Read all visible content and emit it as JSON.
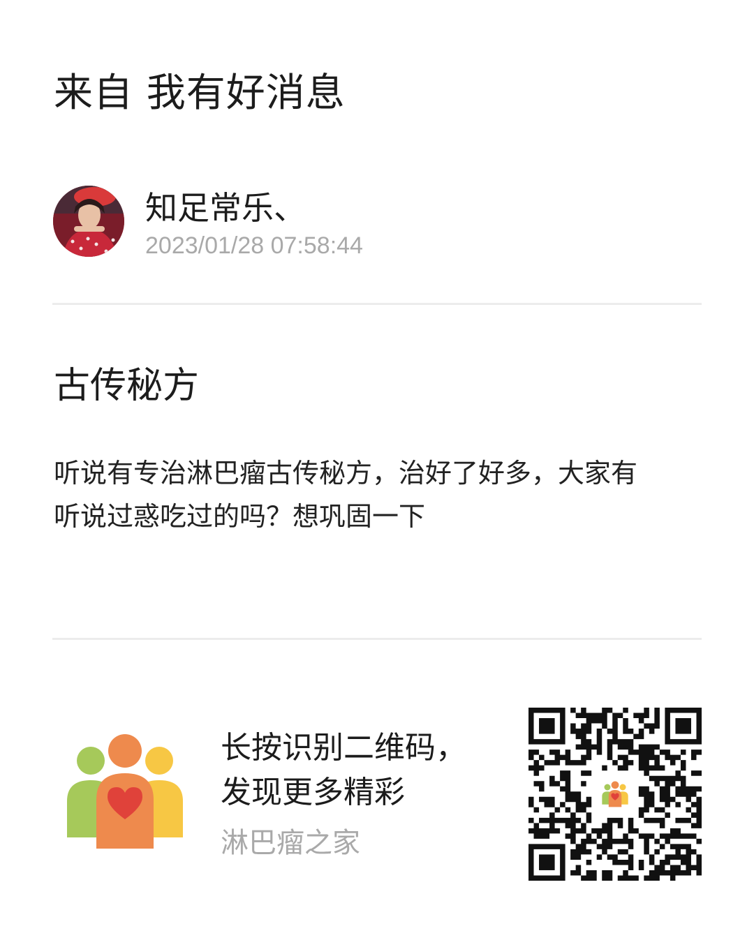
{
  "header": {
    "title": "来自 我有好消息"
  },
  "author": {
    "name": "知足常乐、",
    "timestamp": "2023/01/28 07:58:44",
    "avatar_icon": "user-avatar-photo"
  },
  "post": {
    "title": "古传秘方",
    "body_lines": [
      "听说有专治淋巴瘤古传秘方，治好了好多，大家有",
      "听说过惑吃过的吗？想巩固一下"
    ]
  },
  "promo": {
    "line1": "长按识别二维码，",
    "line2": "发现更多精彩",
    "brand": "淋巴瘤之家",
    "logo_icon": "community-heart-logo-icon",
    "qr_icon": "qr-code-icon",
    "colors": {
      "green": "#a6c95a",
      "orange": "#ee8a4d",
      "yellow": "#f7c744",
      "heart": "#e0423a"
    }
  }
}
